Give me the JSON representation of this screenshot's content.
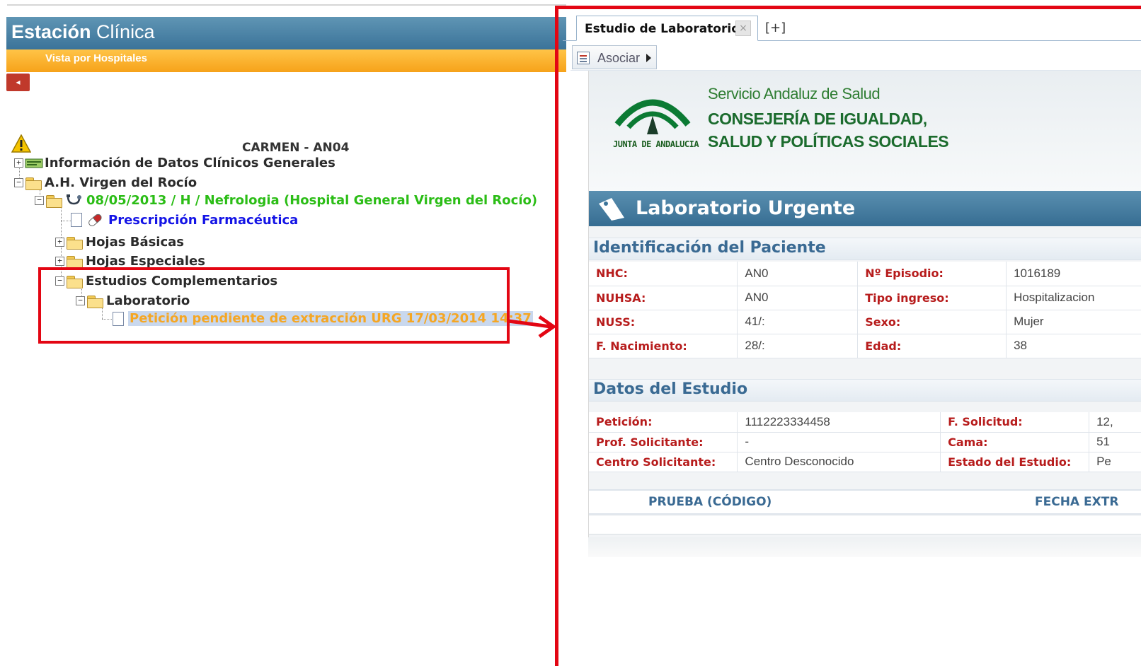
{
  "app": {
    "title_bold": "Estación",
    "title_rest": " Clínica",
    "subtitle": "Vista por Hospitales",
    "back_glyph": "◂"
  },
  "patient": {
    "name": "CARMEN - AN04"
  },
  "tree": {
    "general_info": "Información de Datos Clínicos Generales",
    "hospital": "A.H. Virgen del Rocío",
    "episode": "08/05/2013 / H / Nefrologia (Hospital General Virgen del Rocío)",
    "prescription": "Prescripción Farmacéutica",
    "basic_sheets": "Hojas Básicas",
    "special_sheets": "Hojas Especiales",
    "complementary": "Estudios Complementarios",
    "laboratory": "Laboratorio",
    "pending_request": "Petición pendiente de extracción URG 17/03/2014 14:37",
    "expand_plus": "+",
    "expand_minus": "−"
  },
  "tabs": {
    "active_label": "Estudio de Laboratorio",
    "close_glyph": "×",
    "add_label": "[+]"
  },
  "toolbar": {
    "asociar_label": "Asociar"
  },
  "report": {
    "org_line1": "Servicio Andaluz de Salud",
    "org_line2": "CONSEJERÍA DE IGUALDAD,",
    "org_line3": "SALUD Y POLÍTICAS SOCIALES",
    "junta": "JUNTA DE ANDALUCIA",
    "lab_title": "Laboratorio Urgente",
    "section_patient": "Identificación del Paciente",
    "section_study": "Datos del Estudio",
    "patient_rows": [
      {
        "k1": "NHC:",
        "v1": "AN0",
        "k2": "Nº Episodio:",
        "v2": "1016189"
      },
      {
        "k1": "NUHSA:",
        "v1": "AN0",
        "k2": "Tipo ingreso:",
        "v2": "Hospitalizacion"
      },
      {
        "k1": "NUSS:",
        "v1": "41/:",
        "k2": "Sexo:",
        "v2": "Mujer"
      },
      {
        "k1": "F. Nacimiento:",
        "v1": "28/:",
        "k2": "Edad:",
        "v2": "38"
      }
    ],
    "study_rows": [
      {
        "k1": "Petición:",
        "v1": "1112223334458",
        "k2": "F. Solicitud:",
        "v2": "12,"
      },
      {
        "k1": "Prof. Solicitante:",
        "v1": "-",
        "k2": "Cama:",
        "v2": "51"
      },
      {
        "k1": "Centro Solicitante:",
        "v1": "Centro Desconocido",
        "k2": "Estado del Estudio:",
        "v2": "Pe"
      }
    ],
    "col_test": "PRUEBA (CÓDIGO)",
    "col_date": "FECHA EXTR"
  },
  "colors": {
    "header_blue": "#3b7399",
    "subheader_orange": "#f6a21a",
    "highlight_red": "#e30613",
    "episode_green": "#2bbd16",
    "link_blue": "#1414e6",
    "pending_orange": "#f5a623"
  }
}
